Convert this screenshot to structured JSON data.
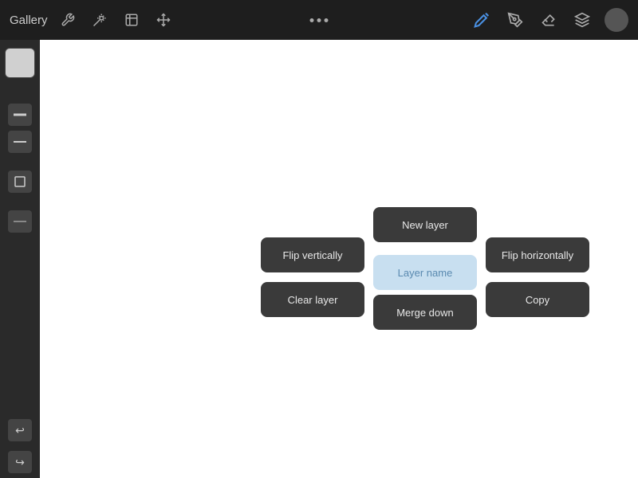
{
  "topbar": {
    "gallery_label": "Gallery",
    "dots_aria": "more options",
    "pencil_icon": "✏",
    "brush_icon": "🖌",
    "eraser_icon": "◻",
    "layers_icon": "⧉"
  },
  "sidebar": {
    "undo_icon": "↩",
    "redo_icon": "↪"
  },
  "context_menu": {
    "new_layer": "New layer",
    "flip_vertically": "Flip vertically",
    "flip_horizontally": "Flip horizontally",
    "rename_placeholder": "Layer name",
    "clear_layer": "Clear layer",
    "copy": "Copy",
    "merge_down": "Merge down"
  }
}
